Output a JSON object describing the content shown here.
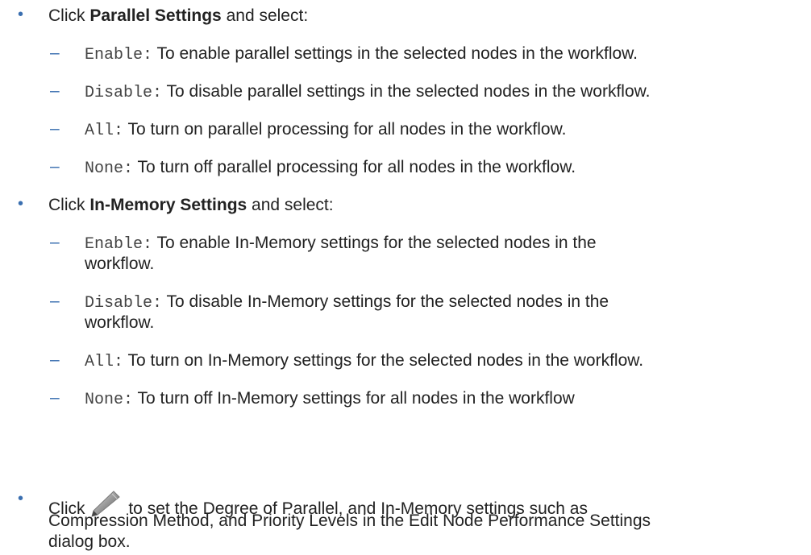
{
  "colors": {
    "accent": "#3a6fb0",
    "text": "#222222",
    "code": "#444444"
  },
  "bullet_glyph": "•",
  "dash_glyph": "–",
  "parallel": {
    "click": "Click ",
    "label": "Parallel Settings",
    "suffix": " and select:",
    "items": [
      {
        "code": "Enable:",
        "text": " To enable parallel settings in the selected nodes in the workflow."
      },
      {
        "code": "Disable:",
        "text": " To disable parallel settings in the selected nodes in the workflow."
      },
      {
        "code": "All:",
        "text": " To turn on parallel processing for all nodes in the workflow."
      },
      {
        "code": "None:",
        "text": " To turn off parallel processing for all nodes in the workflow."
      }
    ]
  },
  "inmemory": {
    "click": "Click ",
    "label": "In-Memory Settings",
    "suffix": " and select:",
    "items": [
      {
        "code": "Enable:",
        "text": " To enable In-Memory settings for the selected nodes in the",
        "cont": "workflow."
      },
      {
        "code": "Disable:",
        "text": " To disable In-Memory settings for the selected nodes in the",
        "cont": "workflow."
      },
      {
        "code": "All:",
        "text": " To turn on In-Memory settings for the selected nodes in the workflow."
      },
      {
        "code": "None:",
        "text": " To turn off In-Memory settings for all nodes in the workflow"
      }
    ]
  },
  "edit": {
    "click": "Click ",
    "icon": "pencil-icon",
    "text1": "to set the Degree of Parallel, and In-Memory settings such as",
    "text2": "Compression Method, and Priority Levels in the Edit Node Performance Settings",
    "text3": "dialog box."
  }
}
